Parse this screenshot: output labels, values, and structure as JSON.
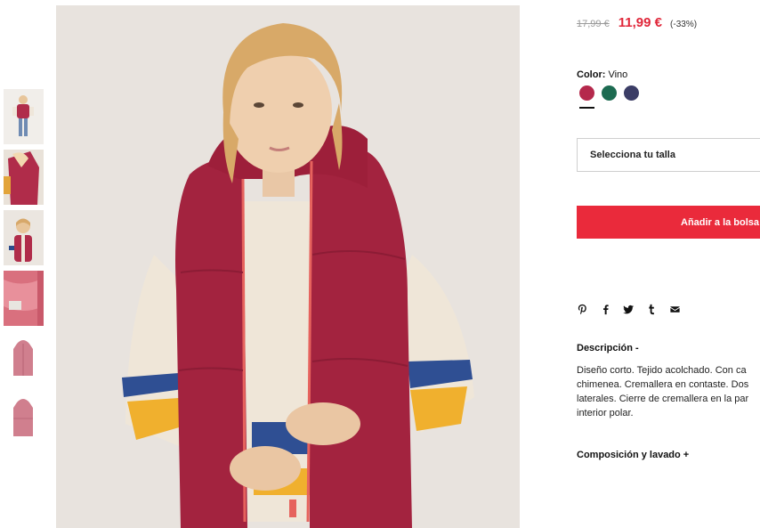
{
  "colors": {
    "sale": "#e0273a",
    "button": "#ea2a3b",
    "swatch_vino": "#b5294c",
    "swatch_green": "#1d6b51",
    "swatch_navy": "#3b3d66"
  },
  "price": {
    "old": "17,99 €",
    "new": "11,99 €",
    "discount": "(-33%)"
  },
  "color_picker": {
    "label": "Color:",
    "selected": "Vino",
    "swatches": [
      "vino",
      "green",
      "navy"
    ]
  },
  "size_select": {
    "placeholder": "Selecciona tu talla"
  },
  "add_to_bag": {
    "label": "Añadir a la bolsa"
  },
  "share_icons": [
    "pinterest-icon",
    "facebook-icon",
    "twitter-icon",
    "tumblr-icon",
    "email-icon"
  ],
  "description": {
    "title": "Descripción -",
    "lines": [
      "Diseño corto. Tejido acolchado. Con ca",
      "chimenea. Cremallera en contaste. Dos",
      "laterales. Cierre de cremallera en la par",
      "interior polar."
    ]
  },
  "composition": {
    "title": "Composición y lavado +"
  },
  "gallery": {
    "thumbnails": [
      "full-body-front",
      "hood-detail",
      "close-up-front",
      "fabric-detail",
      "vest-only-front",
      "vest-only-back"
    ]
  }
}
